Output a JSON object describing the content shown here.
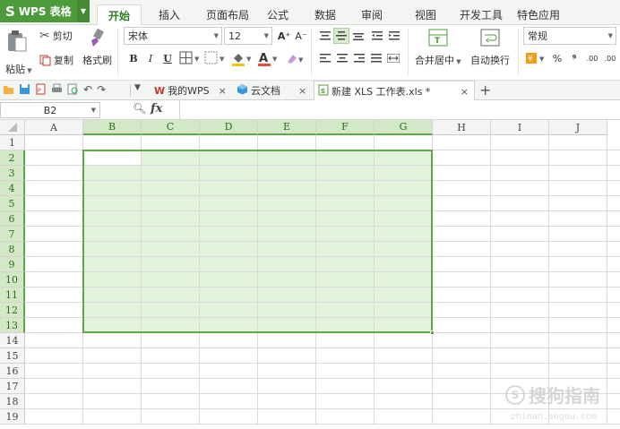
{
  "app": {
    "logo": "WPS 表格",
    "logo_glyph": "S"
  },
  "menu": {
    "tabs": [
      "开始",
      "插入",
      "页面布局",
      "公式",
      "数据",
      "审阅",
      "视图",
      "开发工具",
      "特色应用"
    ],
    "active": "开始"
  },
  "ribbon": {
    "paste": "粘贴",
    "cut": "剪切",
    "copy": "复制",
    "format_painter": "格式刷",
    "font_name": "宋体",
    "font_size": "12",
    "bold": "B",
    "italic": "I",
    "underline": "U",
    "grow_font": "A⁺",
    "shrink_font": "A⁻",
    "merge_center": "合并居中",
    "wrap_text": "自动换行",
    "number_format": "常规",
    "percent": "%",
    "comma": "⁹",
    "inc_decimal": ".00",
    "dec_decimal": ".00"
  },
  "doc_tabs": {
    "my_wps": "我的WPS",
    "cloud_docs": "云文档",
    "active_file": "新建 XLS 工作表.xls *",
    "new_tab": "+"
  },
  "formula_bar": {
    "name_box": "B2",
    "fx": "fx",
    "value": ""
  },
  "sheet": {
    "columns": [
      "A",
      "B",
      "C",
      "D",
      "E",
      "F",
      "G",
      "H",
      "I",
      "J"
    ],
    "rows": [
      "1",
      "2",
      "3",
      "4",
      "5",
      "6",
      "7",
      "8",
      "9",
      "10",
      "11",
      "12",
      "13",
      "14",
      "15",
      "16",
      "17",
      "18",
      "19"
    ],
    "selection": "B2:G13",
    "active_cell": "B2",
    "selection_color": "#e3f2da",
    "selection_border": "#5fa846"
  },
  "watermark": {
    "text": "搜狗指南",
    "sub": "zhinan.sogou.com"
  },
  "colors": {
    "brand": "#4e9b3c",
    "accent": "#2f7d1e"
  }
}
